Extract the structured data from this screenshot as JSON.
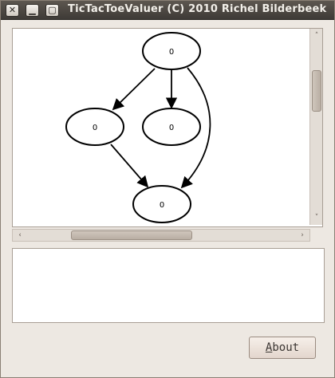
{
  "window": {
    "title": "TicTacToeValuer (C) 2010 Richel Bilderbeek",
    "buttons": {
      "close": "✕",
      "minimize": "▁",
      "maximize": "▢"
    }
  },
  "graph": {
    "nodes": [
      {
        "id": "top",
        "label": "0"
      },
      {
        "id": "mid-left",
        "label": "0"
      },
      {
        "id": "mid-right",
        "label": "0"
      },
      {
        "id": "bottom",
        "label": "0"
      }
    ],
    "edges": [
      {
        "from": "top",
        "to": "mid-left"
      },
      {
        "from": "top",
        "to": "mid-right"
      },
      {
        "from": "top",
        "to": "bottom"
      },
      {
        "from": "mid-left",
        "to": "bottom"
      }
    ]
  },
  "scroll": {
    "up_arrow": "˄",
    "down_arrow": "˅",
    "left_arrow": "‹",
    "right_arrow": "›"
  },
  "output": {
    "text": ""
  },
  "about_button": {
    "first_letter": "A",
    "rest": "bout"
  },
  "colors": {
    "titlebar": "#4a4540",
    "background": "#ede8e2"
  }
}
